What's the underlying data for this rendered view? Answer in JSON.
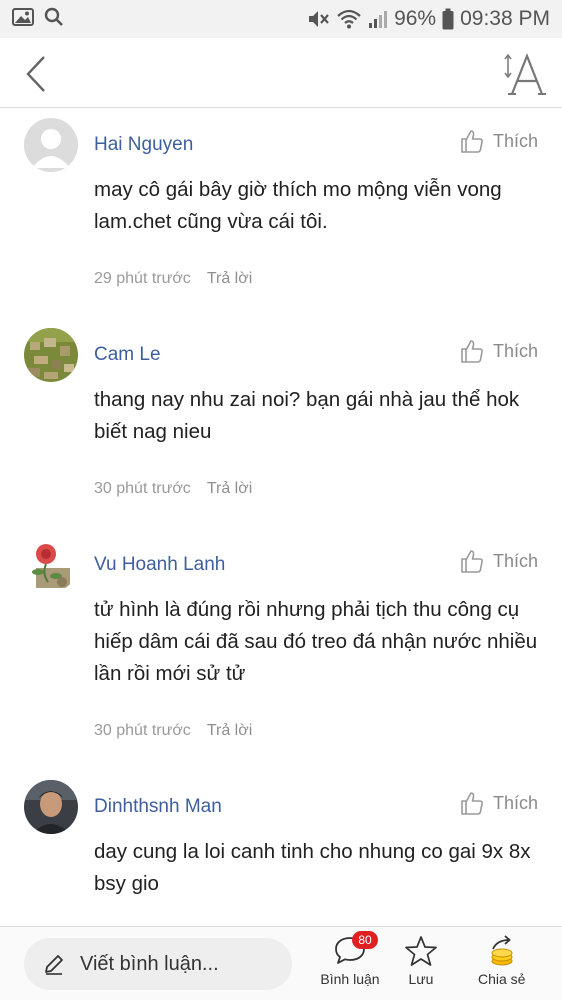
{
  "status_bar": {
    "battery": "96%",
    "time": "09:38 PM",
    "icons": [
      "image-icon",
      "search-icon",
      "mute-icon",
      "wifi-icon",
      "signal-icon",
      "battery-icon"
    ]
  },
  "app_bar": {
    "icons": [
      "back-arrow-icon",
      "font-size-icon"
    ]
  },
  "comments": [
    {
      "author": "Hai Nguyen",
      "avatar": "default-avatar",
      "like_label": "Thích",
      "text": "may cô gái bây giờ thích mo mộng viễn vong lam.chet cũng vừa cái tôi.",
      "time": "29 phút trước",
      "reply_label": "Trả lời"
    },
    {
      "author": "Cam Le",
      "avatar": "landscape-avatar",
      "like_label": "Thích",
      "text": "thang nay nhu zai noi? bạn gái nhà jau thể hok biết nag nieu",
      "time": "30 phút trước",
      "reply_label": "Trả lời"
    },
    {
      "author": "Vu Hoanh Lanh",
      "avatar": "rose-avatar",
      "like_label": "Thích",
      "text": "tử hình là đúng rồi nhưng phải tịch thu công cụ hiếp dâm cái đã sau đó treo đá nhận nước nhiều lần rồi mới sử tử",
      "time": "30 phút trước",
      "reply_label": "Trả lời"
    },
    {
      "author": "Dinhthsnh Man",
      "avatar": "photo-avatar",
      "like_label": "Thích",
      "text": "day cung la loi canh tinh cho nhung co gai 9x 8x bsy gio"
    }
  ],
  "bottom_bar": {
    "write_placeholder": "Viết bình luận...",
    "comments_label": "Bình luận",
    "comments_count": "80",
    "save_label": "Lưu",
    "share_label": "Chia sẻ",
    "colors": {
      "badge": "#e02020",
      "author": "#3f5f9c"
    }
  }
}
